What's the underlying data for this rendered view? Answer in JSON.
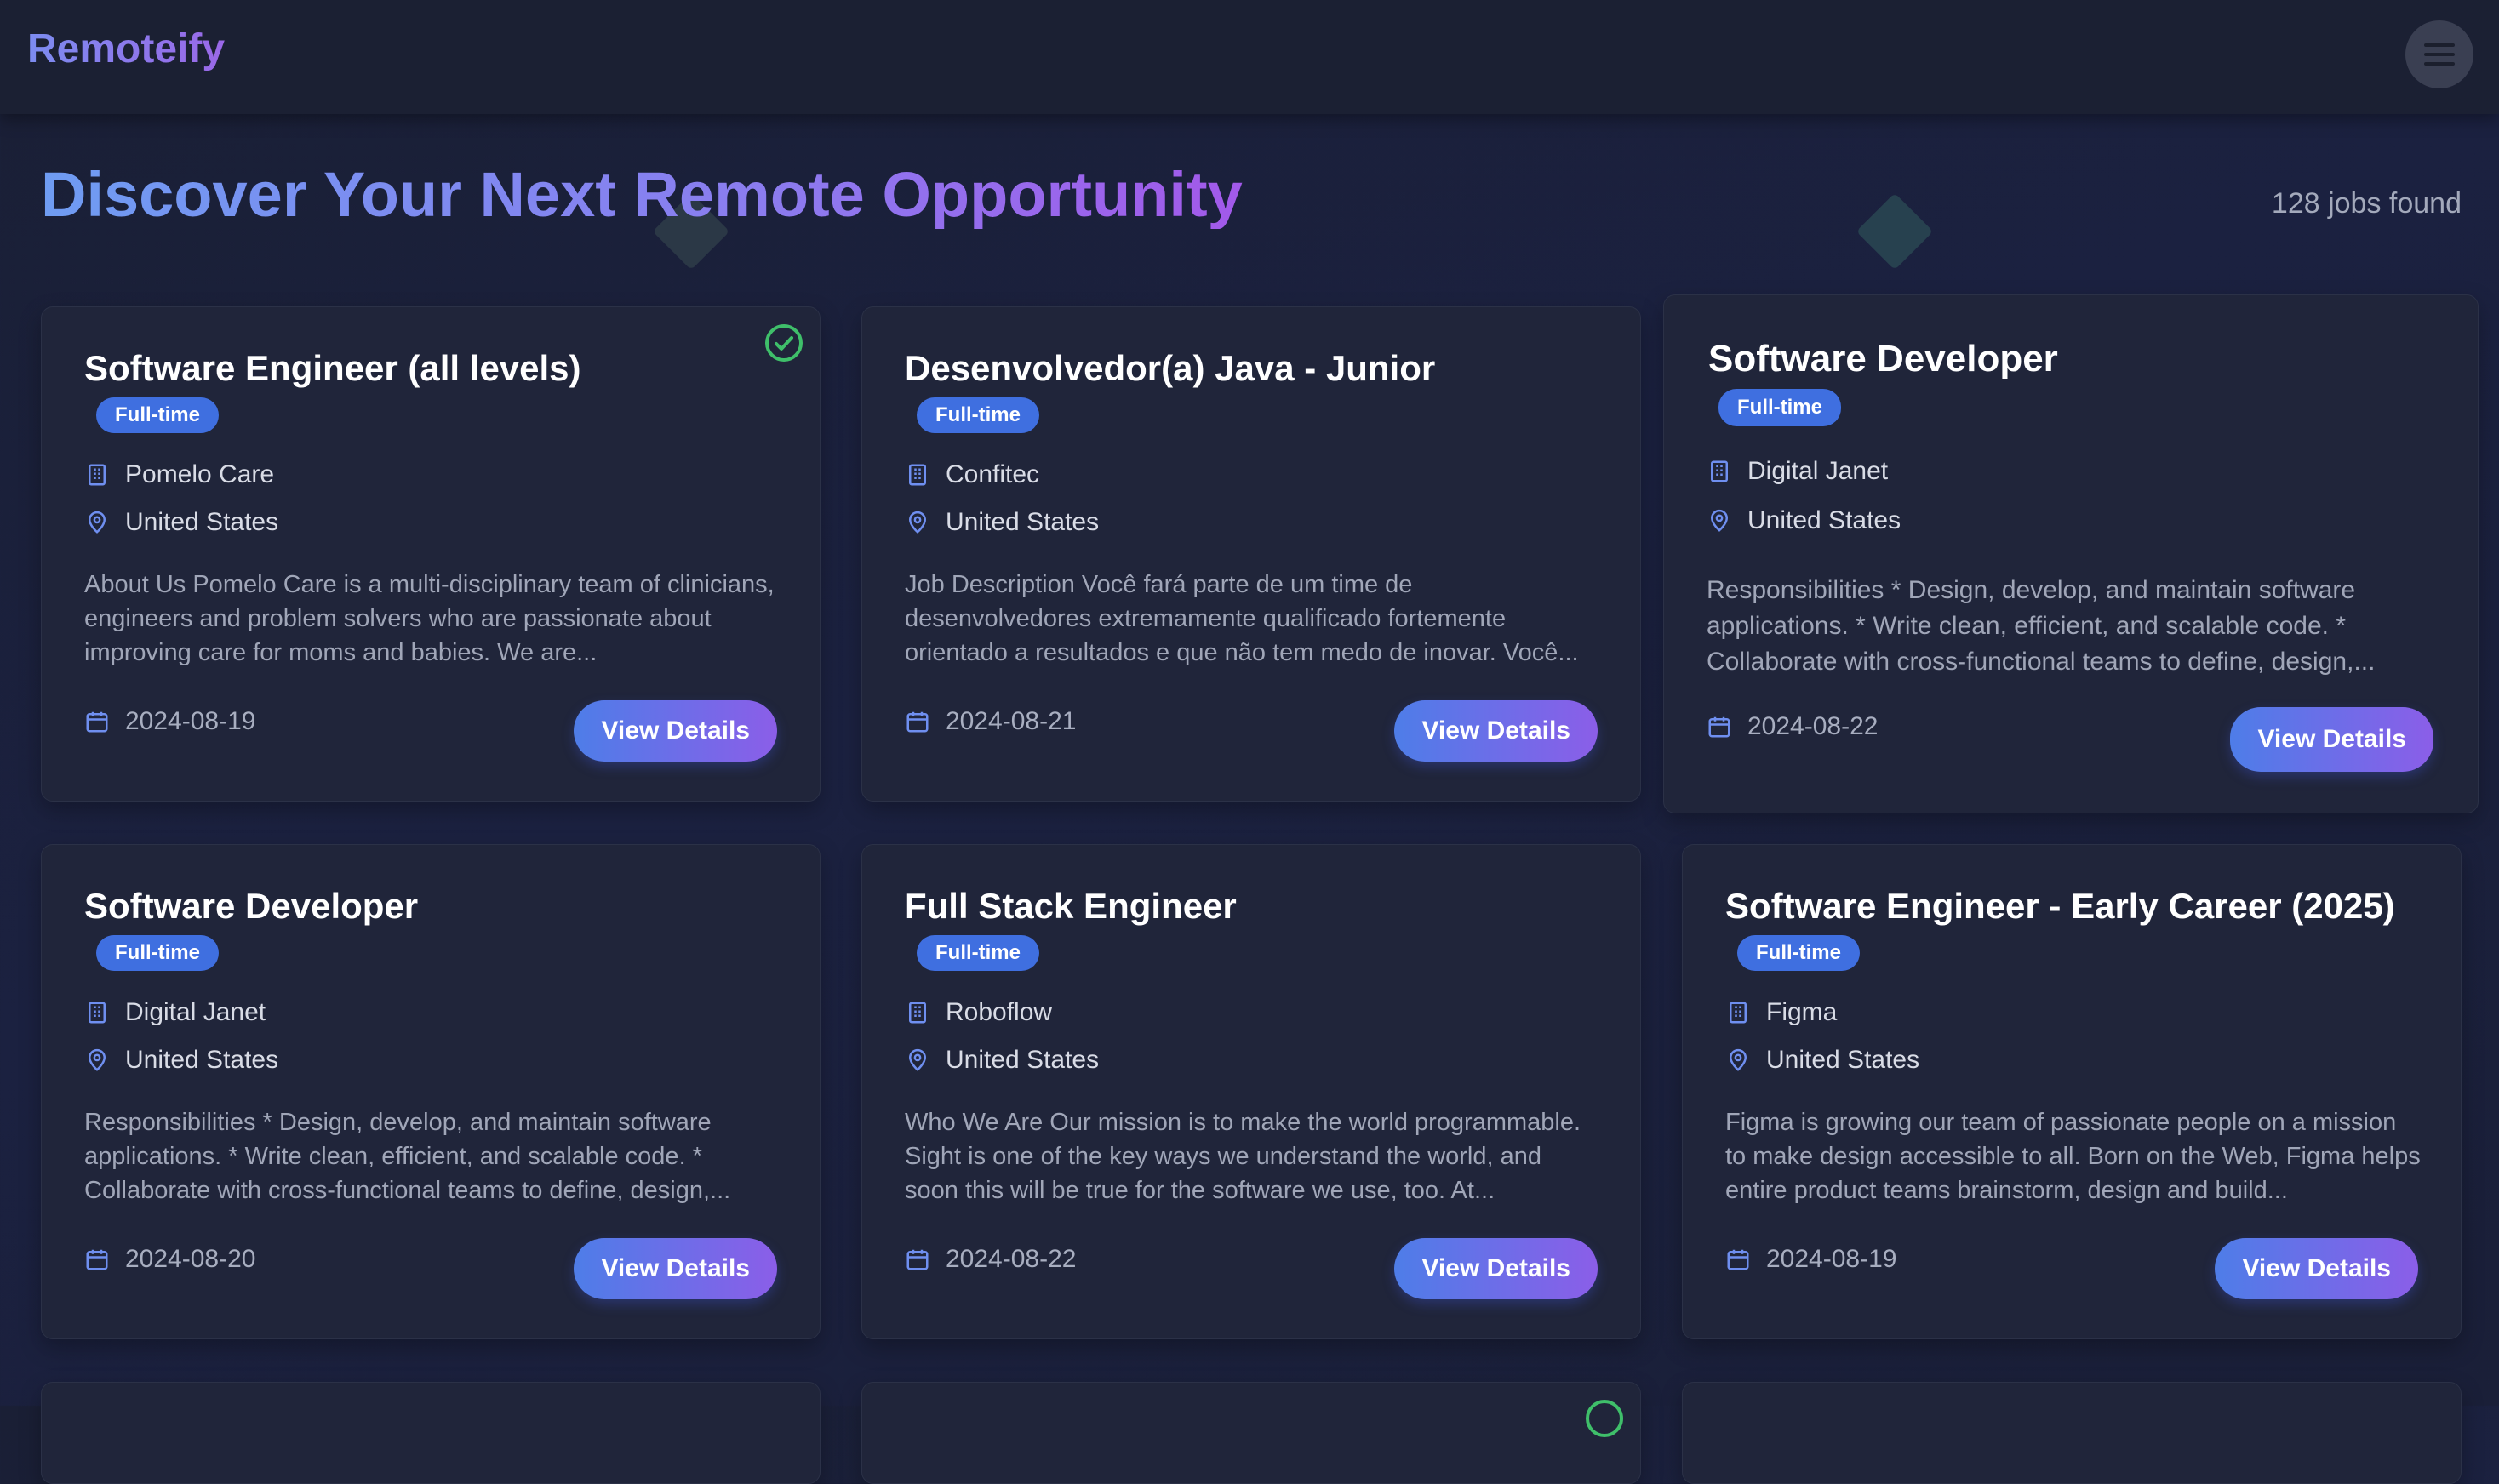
{
  "app": {
    "logo": "Remoteify",
    "menu_icon": "hamburger-menu-icon"
  },
  "page": {
    "title": "Discover Your Next Remote Opportunity",
    "jobs_found": "128 jobs found"
  },
  "colors": {
    "background": "#1b2140",
    "card": "#20253a",
    "badge": "#3f6fe0",
    "button_gradient_start": "#4e7de8",
    "button_gradient_end": "#8b5ee8",
    "check": "#3fbf6a"
  },
  "jobs": [
    {
      "title": "Software Engineer (all levels)",
      "type": "Full-time",
      "company": "Pomelo Care",
      "location": "United States",
      "description": "About Us Pomelo Care is a multi-disciplinary team of clinicians, engineers and problem solvers who are passionate about improving care for moms and babies. We are...",
      "date": "2024-08-19",
      "button": "View Details",
      "viewed": true
    },
    {
      "title": "Desenvolvedor(a) Java - Junior",
      "type": "Full-time",
      "company": "Confitec",
      "location": "United States",
      "description": "Job Description Você fará parte de um time de desenvolvedores extremamente qualificado fortemente orientado a resultados e que não tem medo de inovar. Você...",
      "date": "2024-08-21",
      "button": "View Details",
      "viewed": false
    },
    {
      "title": "Software Developer",
      "type": "Full-time",
      "company": "Digital Janet",
      "location": "United States",
      "description": "Responsibilities * Design, develop, and maintain software applications. * Write clean, efficient, and scalable code. * Collaborate with cross-functional teams to define, design,...",
      "date": "2024-08-22",
      "button": "View Details",
      "viewed": false
    },
    {
      "title": "Software Developer",
      "type": "Full-time",
      "company": "Digital Janet",
      "location": "United States",
      "description": "Responsibilities * Design, develop, and maintain software applications. * Write clean, efficient, and scalable code. * Collaborate with cross-functional teams to define, design,...",
      "date": "2024-08-20",
      "button": "View Details",
      "viewed": false
    },
    {
      "title": "Full Stack Engineer",
      "type": "Full-time",
      "company": "Roboflow",
      "location": "United States",
      "description": "Who We Are Our mission is to make the world programmable. Sight is one of the key ways we understand the world, and soon this will be true for the software we use, too. At...",
      "date": "2024-08-22",
      "button": "View Details",
      "viewed": false
    },
    {
      "title": "Software Engineer - Early Career (2025)",
      "type": "Full-time",
      "company": "Figma",
      "location": "United States",
      "description": "Figma is growing our team of passionate people on a mission to make design accessible to all. Born on the Web, Figma helps entire product teams brainstorm, design and build...",
      "date": "2024-08-19",
      "button": "View Details",
      "viewed": false
    }
  ]
}
